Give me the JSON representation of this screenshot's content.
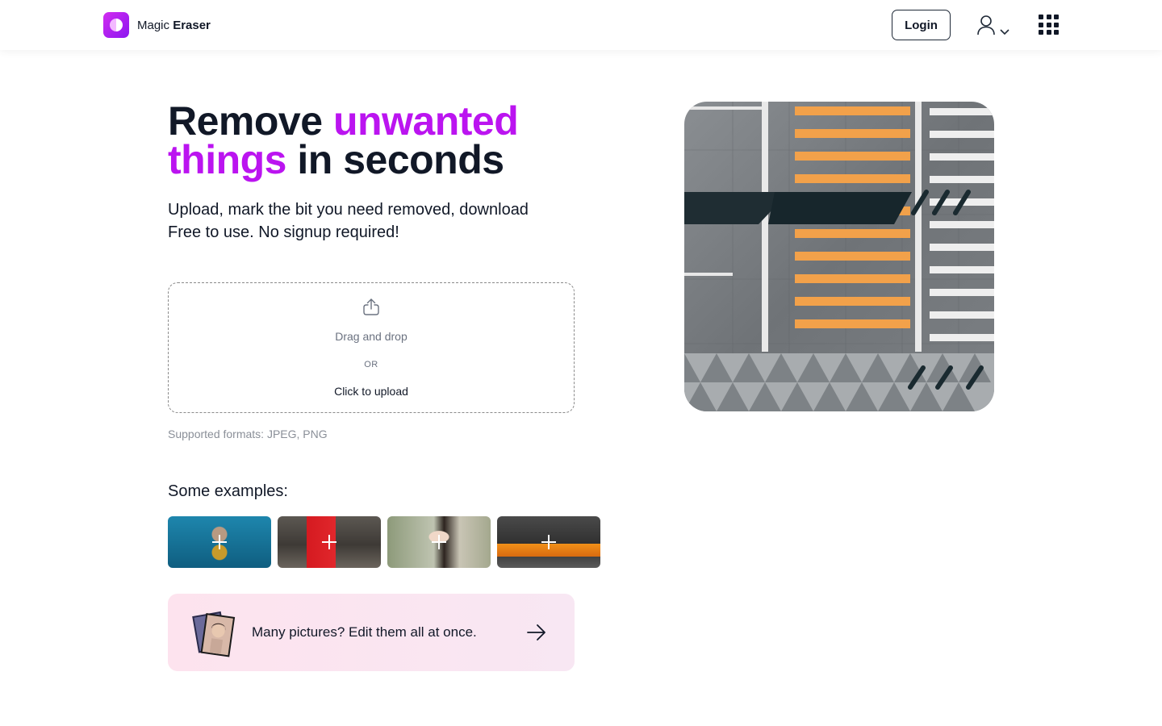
{
  "header": {
    "brand_first": "Magic",
    "brand_second": "Eraser",
    "login_label": "Login",
    "user_icon": "user-icon",
    "apps_icon": "grid-icon"
  },
  "hero": {
    "headline_part1": "Remove ",
    "headline_accent1": "unwanted",
    "headline_accent2": "things",
    "headline_part2": " in seconds",
    "subtitle_line1": "Upload, mark the bit you need removed, download",
    "subtitle_line2": "Free to use. No signup required!"
  },
  "upload": {
    "drag_text": "Drag and drop",
    "or_text": "OR",
    "click_text": "Click to upload",
    "formats": "Supported formats: JPEG, PNG"
  },
  "examples": {
    "title": "Some examples:"
  },
  "batch": {
    "text": "Many pictures? Edit them all at once."
  },
  "colors": {
    "accent": "#bb14f0",
    "text": "#111827"
  }
}
